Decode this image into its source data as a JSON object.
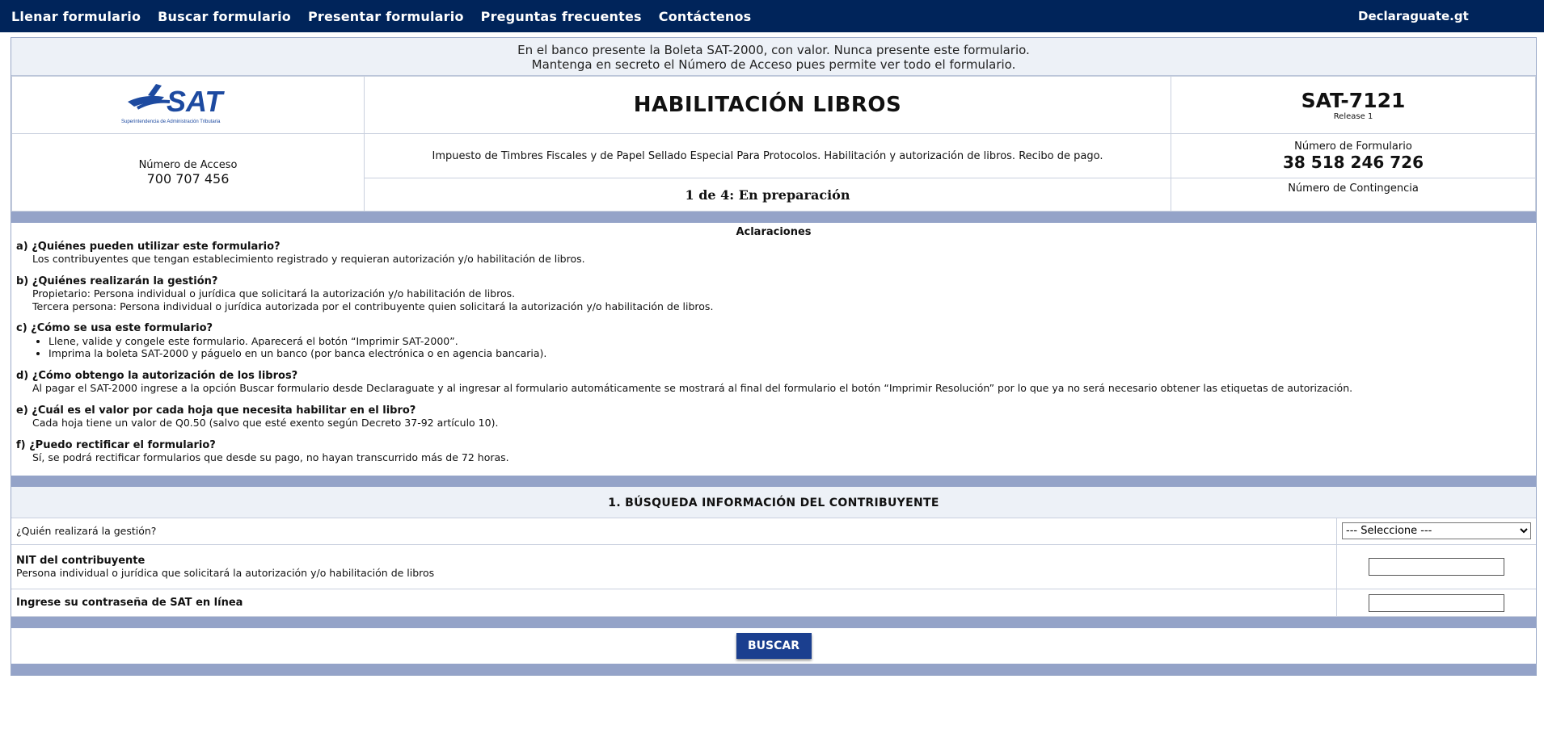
{
  "nav": {
    "items": [
      "Llenar formulario",
      "Buscar formulario",
      "Presentar formulario",
      "Preguntas frecuentes",
      "Contáctenos"
    ],
    "brand": "Declaraguate.gt"
  },
  "banner": {
    "line1": "En el banco presente la Boleta SAT-2000, con valor. Nunca presente este formulario.",
    "line2": "Mantenga en secreto el Número de Acceso pues permite ver todo el formulario."
  },
  "header": {
    "logo_text": "SAT",
    "logo_subtext": "Superintendencia de Administración Tributaria",
    "title": "HABILITACIÓN LIBROS",
    "form_code": "SAT-7121",
    "release": "Release 1",
    "access_label": "Número de Acceso",
    "access_number": "700 707 456",
    "description": "Impuesto de Timbres Fiscales y de Papel Sellado Especial Para Protocolos. Habilitación y autorización de libros. Recibo de pago.",
    "form_number_label": "Número de Formulario",
    "form_number": "38 518 246 726",
    "status": "1 de 4: En preparación",
    "contingency_label": "Número de Contingencia"
  },
  "clarifications": {
    "title": "Aclaraciones",
    "a_q": "a) ¿Quiénes pueden utilizar este formulario?",
    "a_1": "Los contribuyentes que tengan establecimiento registrado y requieran autorización y/o habilitación de libros.",
    "b_q": "b) ¿Quiénes realizarán la gestión?",
    "b_1": "Propietario: Persona individual o jurídica que solicitará la autorización y/o habilitación de libros.",
    "b_2": "Tercera persona: Persona individual o jurídica autorizada por el contribuyente quien solicitará la autorización y/o habilitación de libros.",
    "c_q": "c) ¿Cómo se usa este formulario?",
    "c_1": "Llene, valide y congele este formulario. Aparecerá el botón “Imprimir SAT-2000”.",
    "c_2": "Imprima la boleta SAT-2000 y páguelo en un banco (por banca electrónica o en agencia bancaria).",
    "d_q": "d) ¿Cómo obtengo la autorización de los libros?",
    "d_1": "Al pagar el SAT-2000 ingrese a la opción Buscar formulario desde Declaraguate y al ingresar al formulario automáticamente se mostrará al final del formulario el botón “Imprimir Resolución” por lo que ya no será necesario obtener las etiquetas de autorización.",
    "e_q": "e) ¿Cuál es el valor por cada hoja que necesita habilitar en el libro?",
    "e_1": "Cada hoja tiene un valor de Q0.50 (salvo que esté exento según Decreto 37-92 artículo 10).",
    "f_q": "f) ¿Puedo rectificar el formulario?",
    "f_1": "Sí, se podrá rectificar formularios que desde su pago, no hayan transcurrido más de 72 horas."
  },
  "section1": {
    "title": "1. BÚSQUEDA INFORMACIÓN DEL CONTRIBUYENTE",
    "who_label": "¿Quién realizará la gestión?",
    "who_select": "--- Seleccione ---",
    "nit_label": "NIT del contribuyente",
    "nit_desc": "Persona individual o jurídica que solicitará la autorización y/o habilitación de libros",
    "password_label": "Ingrese su contraseña de SAT en línea",
    "search_button": "BUSCAR"
  },
  "colors": {
    "nav_bg": "#00245a",
    "stripe": "#94a3c8",
    "panel_bg": "#edf1f7",
    "button_bg": "#1b3f8f",
    "logo_blue": "#1d4aa0"
  }
}
